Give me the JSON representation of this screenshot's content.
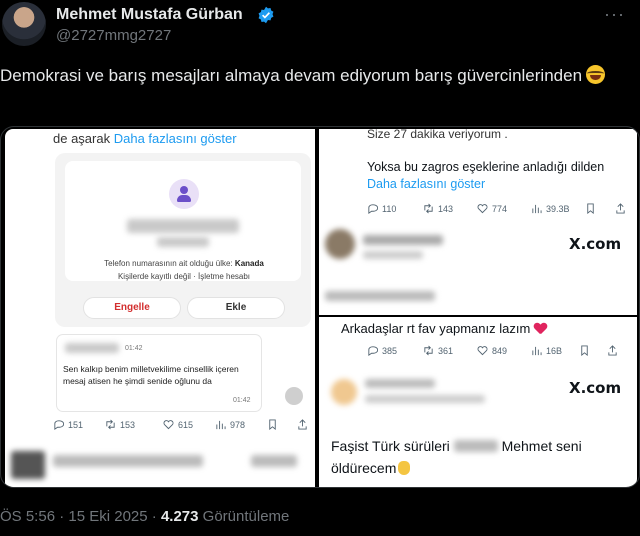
{
  "author": {
    "name": "Mehmet Mustafa Gürban",
    "handle": "@2727mmg2727"
  },
  "more_label": "···",
  "tweet": {
    "text": "Demokrasi ve barış mesajları almaya devam ediyorum barış güvercinlerinden"
  },
  "left_panel": {
    "top_prefix": "de aşarak",
    "top_link": "Daha fazlasını göster",
    "card_line1_prefix": "Telefon numarasının ait olduğu ülke:",
    "card_line1_country": "Kanada",
    "card_line2": "Kişilerde kayıtlı değil · İşletme hesabı",
    "block_button": "Engelle",
    "add_button": "Ekle",
    "bubble_time1": "01:42",
    "bubble_text": "Sen kalkıp benim milletvekilime cinsellik içeren mesaj atisen he şimdi senide oğlunu da",
    "bubble_time2": "01:42",
    "stats": {
      "replies": "151",
      "retweets": "153",
      "likes": "615",
      "views": "978"
    }
  },
  "right_top_panel": {
    "top_text": "Size 27 dakika veriyorum .",
    "text": "Yoksa bu zagros eşeklerine anladığı dilden",
    "link": "Daha fazlasını göster",
    "stats": {
      "replies": "110",
      "retweets": "143",
      "likes": "774",
      "views": "39.3B"
    },
    "xcom": "X.com"
  },
  "right_bottom_panel": {
    "text1": "Arkadaşlar rt fav yapmanız lazım",
    "stats": {
      "replies": "385",
      "retweets": "361",
      "likes": "849",
      "views": "16B"
    },
    "xcom": "X.com",
    "text2_a": "Faşist Türk sürüleri",
    "text2_b": "Mehmet seni öldürecem"
  },
  "footer": {
    "time": "ÖS 5:56 · 15 Eki 2025 ·",
    "views": "4.273",
    "views_label": "Görüntüleme"
  }
}
